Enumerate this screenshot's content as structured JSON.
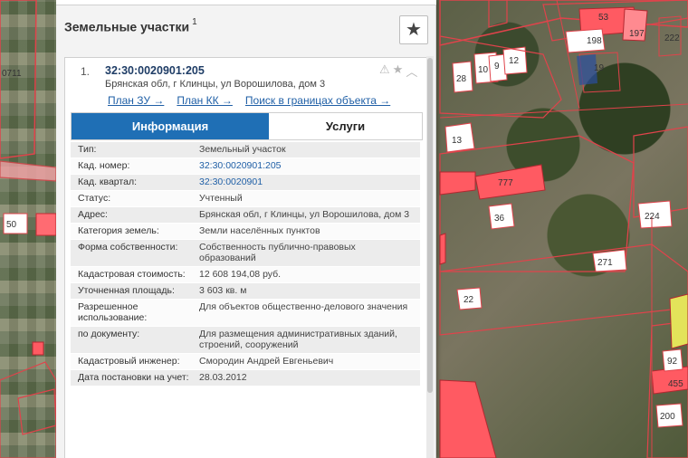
{
  "map": {
    "parcel_labels": [
      "0711",
      "50",
      "13",
      "777",
      "36",
      "271",
      "22",
      "224",
      "53",
      "198",
      "197",
      "19",
      "222",
      "28",
      "10",
      "9",
      "12",
      "92",
      "200",
      "455"
    ]
  },
  "panel": {
    "title": "Земельные участки",
    "title_count": "1",
    "favorite_icon": "star-icon"
  },
  "result": {
    "number": "1.",
    "cadastral_number": "32:30:0020901:205",
    "address": "Брянская обл, г Клинцы, ул Ворошилова, дом 3",
    "icons": [
      "warning-icon",
      "star-icon",
      "chevron-up-icon"
    ],
    "links": {
      "plan_zu": "План ЗУ →",
      "plan_kk": "План КК →",
      "search_bounds": "Поиск в границах объекта →"
    }
  },
  "tabs": {
    "info": "Информация",
    "services": "Услуги"
  },
  "info_rows": [
    {
      "key": "Тип:",
      "value": "Земельный участок"
    },
    {
      "key": "Кад. номер:",
      "value": "32:30:0020901:205"
    },
    {
      "key": "Кад. квартал:",
      "value": "32:30:0020901"
    },
    {
      "key": "Статус:",
      "value": "Учтенный"
    },
    {
      "key": "Адрес:",
      "value": "Брянская обл, г Клинцы, ул Ворошилова, дом 3"
    },
    {
      "key": "Категория земель:",
      "value": "Земли населённых пунктов"
    },
    {
      "key": "Форма собственности:",
      "value": "Собственность публично-правовых образований"
    },
    {
      "key": "Кадастровая стоимость:",
      "value": "12 608 194,08 руб."
    },
    {
      "key": "Уточненная площадь:",
      "value": "3 603 кв. м"
    },
    {
      "key": "Разрешенное использование:",
      "value": "Для объектов общественно-делового значения"
    },
    {
      "key": "по документу:",
      "value": "Для размещения административных зданий, строений, сооружений"
    },
    {
      "key": "Кадастровый инженер:",
      "value": "Смородин Андрей Евгеньевич"
    },
    {
      "key": "Дата постановки на учет:",
      "value": "28.03.2012"
    }
  ]
}
